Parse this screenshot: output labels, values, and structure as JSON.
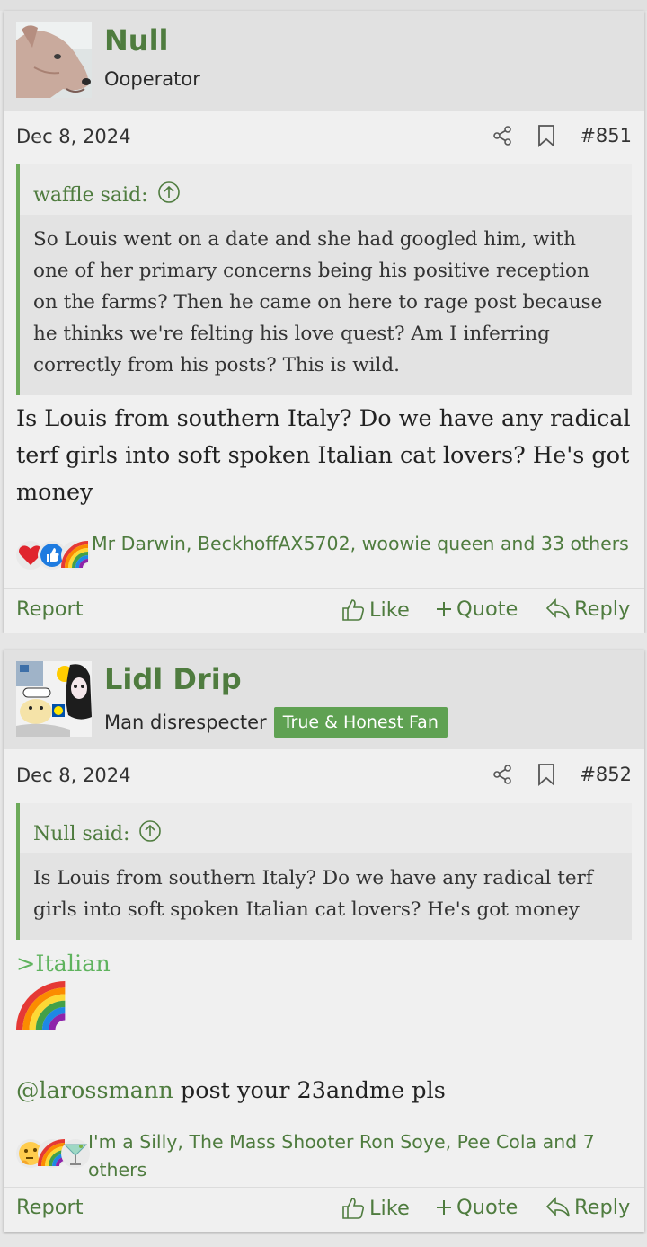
{
  "posts": [
    {
      "username": "Null",
      "user_title": "Ooperator",
      "banner": "",
      "date": "Dec 8, 2024",
      "post_number": "#851",
      "quote": {
        "author": "waffle said:",
        "text": "So Louis went on a date and she had googled him, with one of her primary concerns being his positive reception on the farms? Then he came on here to rage post because he thinks we're felting his love quest? Am I inferring correctly from his posts? This is wild."
      },
      "message": "Is Louis from southern Italy? Do we have any radical terf girls into soft spoken Italian cat lovers? He's got money",
      "reactions_text": "Mr Darwin, BeckhoffAX5702, woowie queen and 33 others",
      "reaction_icons": [
        "heart-icon",
        "like-icon",
        "rainbow-icon"
      ]
    },
    {
      "username": "Lidl Drip",
      "user_title": "Man disrespecter",
      "banner": "True & Honest Fan",
      "date": "Dec 8, 2024",
      "post_number": "#852",
      "quote": {
        "author": "Null said:",
        "text": "Is Louis from southern Italy? Do we have any radical terf girls into soft spoken Italian cat lovers? He's got money"
      },
      "greentext": ">Italian",
      "emoji": "🌈",
      "mention": "@larossmann",
      "message_tail": " post your 23andme pls",
      "reactions_text": "I'm a Silly, The Mass Shooter Ron Soye, Pee Cola and 7 others",
      "reaction_icons": [
        "thinking-icon",
        "rainbow-icon",
        "cocktail-icon"
      ]
    }
  ],
  "actions": {
    "report": "Report",
    "like": "Like",
    "quote": "Quote",
    "reply": "Reply"
  },
  "colors": {
    "accent": "#4f7c3f",
    "quote_border": "#6daa5a",
    "banner": "#5fa152",
    "greentext": "#5fb35e"
  }
}
